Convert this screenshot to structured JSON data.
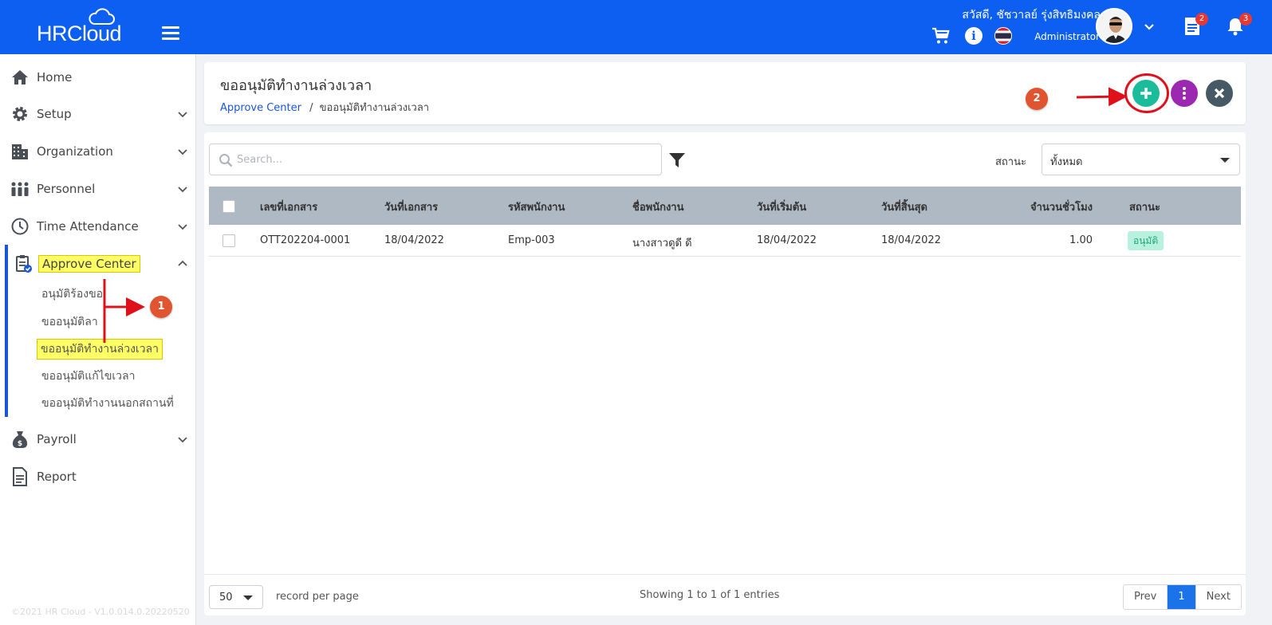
{
  "app": {
    "logo_text": "HRCloud"
  },
  "topbar": {
    "greeting": "สวัสดี, ชัชวาลย์ รุ่งสิทธิมงคล",
    "role": "Administrator",
    "documents_badge": "2",
    "notifications_badge": "3",
    "icons": [
      "menu-icon",
      "cart-icon",
      "info-icon",
      "thai-flag-icon",
      "chevron-down-icon",
      "document-icon",
      "bell-icon"
    ]
  },
  "sidebar": {
    "items": [
      {
        "label": "Home",
        "icon": "home-icon"
      },
      {
        "label": "Setup",
        "icon": "gear-icon"
      },
      {
        "label": "Organization",
        "icon": "building-icon"
      },
      {
        "label": "Personnel",
        "icon": "people-icon"
      },
      {
        "label": "Time Attendance",
        "icon": "clock-icon"
      },
      {
        "label": "Approve Center",
        "icon": "clipboard-check-icon"
      },
      {
        "label": "Payroll",
        "icon": "money-bag-icon"
      },
      {
        "label": "Report",
        "icon": "report-icon"
      }
    ],
    "approve_sub": [
      "อนุมัติร้องขอ",
      "ขออนุมัติลา",
      "ขออนุมัติทำงานล่วงเวลา",
      "ขออนุมัติแก้ไขเวลา",
      "ขออนุมัติทำงานนอกสถานที่"
    ],
    "footer": "©2021 HR Cloud - V1.0.014.0.20220520"
  },
  "header": {
    "title": "ขออนุมัติทำงานล่วงเวลา",
    "breadcrumb": {
      "link": "Approve Center",
      "separator": "/",
      "current": "ขออนุมัติทำงานล่วงเวลา"
    }
  },
  "annotations": {
    "step1": "1",
    "step2": "2",
    "arrow_color": "#e0101a",
    "highlight_color": "#ffff66"
  },
  "toolbar": {
    "search_placeholder": "Search...",
    "status_label": "สถานะ",
    "status_value": "ทั้งหมด"
  },
  "table": {
    "columns": [
      "เลขที่เอกสาร",
      "วันที่เอกสาร",
      "รหัสพนักงาน",
      "ชื่อพนักงาน",
      "วันที่เริ่มต้น",
      "วันที่สิ้นสุด",
      "จำนวนชั่วโมง",
      "สถานะ"
    ],
    "rows": [
      {
        "doc_no": "OTT202204-0001",
        "doc_date": "18/04/2022",
        "emp_code": "Emp-003",
        "emp_name": "นางสาวดูดี ดี",
        "start_date": "18/04/2022",
        "end_date": "18/04/2022",
        "hours": "1.00",
        "status": "อนุมัติ"
      }
    ]
  },
  "pagination": {
    "per_page": "50",
    "per_page_label": "record per page",
    "showing": "Showing 1 to 1 of 1 entries",
    "prev": "Prev",
    "current": "1",
    "next": "Next"
  },
  "colors": {
    "topbar": "#0d5ff2",
    "add_button": "#1abc9c",
    "more_button": "#9c27b0",
    "close_button": "#455a64",
    "status_approved_bg": "#b9f1df",
    "status_approved_text": "#1fa67a"
  }
}
